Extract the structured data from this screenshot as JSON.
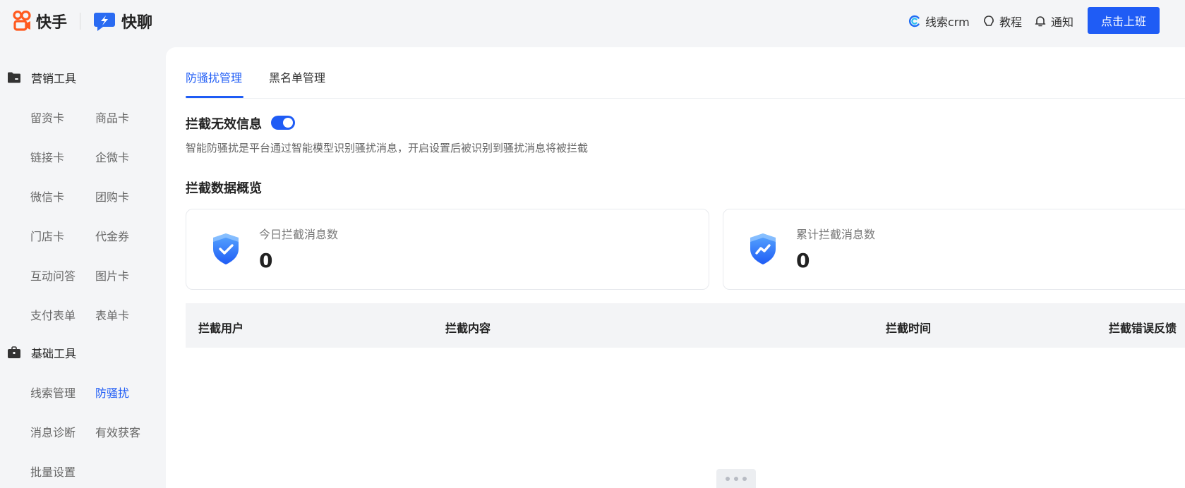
{
  "brand": {
    "kuaishou": "快手",
    "kuailiao": "快聊"
  },
  "topnav": {
    "crm": "线索crm",
    "tutorial": "教程",
    "notice": "通知",
    "clock_in": "点击上班"
  },
  "sidebar": {
    "groups": [
      {
        "title": "营销工具",
        "icon": "folder-icon",
        "items": [
          "留资卡",
          "商品卡",
          "链接卡",
          "企微卡",
          "微信卡",
          "团购卡",
          "门店卡",
          "代金券",
          "互动问答",
          "图片卡",
          "支付表单",
          "表单卡"
        ]
      },
      {
        "title": "基础工具",
        "icon": "briefcase-icon",
        "items": [
          "线索管理",
          "防骚扰",
          "消息诊断",
          "有效获客",
          "批量设置"
        ]
      }
    ],
    "active_item": "防骚扰"
  },
  "tabs": [
    {
      "label": "防骚扰管理",
      "active": true
    },
    {
      "label": "黑名单管理",
      "active": false
    }
  ],
  "intercept": {
    "title": "拦截无效信息",
    "enabled": true,
    "description": "智能防骚扰是平台通过智能模型识别骚扰消息，开启设置后被识别到骚扰消息将被拦截"
  },
  "overview": {
    "title": "拦截数据概览",
    "cards": [
      {
        "label": "今日拦截消息数",
        "value": "0",
        "icon": "shield-check-icon"
      },
      {
        "label": "累计拦截消息数",
        "value": "0",
        "icon": "shield-trend-icon"
      }
    ]
  },
  "table": {
    "columns": [
      "拦截用户",
      "拦截内容",
      "拦截时间",
      "拦截错误反馈"
    ]
  },
  "colors": {
    "accent": "#1f5cf5",
    "kuaishou_orange": "#ff5a1f",
    "kuailiao_blue": "#2a6bf2"
  }
}
